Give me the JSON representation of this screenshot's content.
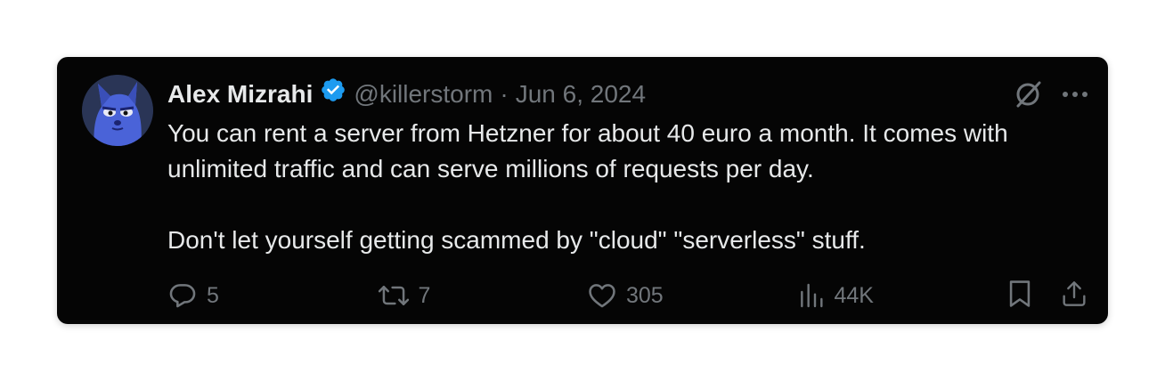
{
  "tweet": {
    "author_name": "Alex Mizrahi",
    "handle": "@killerstorm",
    "separator": "·",
    "date": "Jun 6, 2024",
    "text_paragraphs": [
      "You can rent a server from Hetzner for about 40 euro a month. It comes with unlimited traffic and can serve millions of requests per day.",
      "Don't let yourself getting scammed by \"cloud\" \"serverless\" stuff."
    ],
    "stats": {
      "replies": "5",
      "retweets": "7",
      "likes": "305",
      "views": "44K"
    }
  },
  "icons": {
    "verified": "verified-badge-icon",
    "top_right": [
      "x-logo-slash-icon",
      "more-icon"
    ],
    "actions": [
      "reply-icon",
      "retweet-icon",
      "like-icon",
      "views-icon",
      "bookmark-icon",
      "share-icon"
    ]
  },
  "colors": {
    "card_bg": "#050505",
    "text_primary": "#e7e9ea",
    "text_secondary": "#71767b",
    "verified_blue": "#1d9bf0"
  }
}
